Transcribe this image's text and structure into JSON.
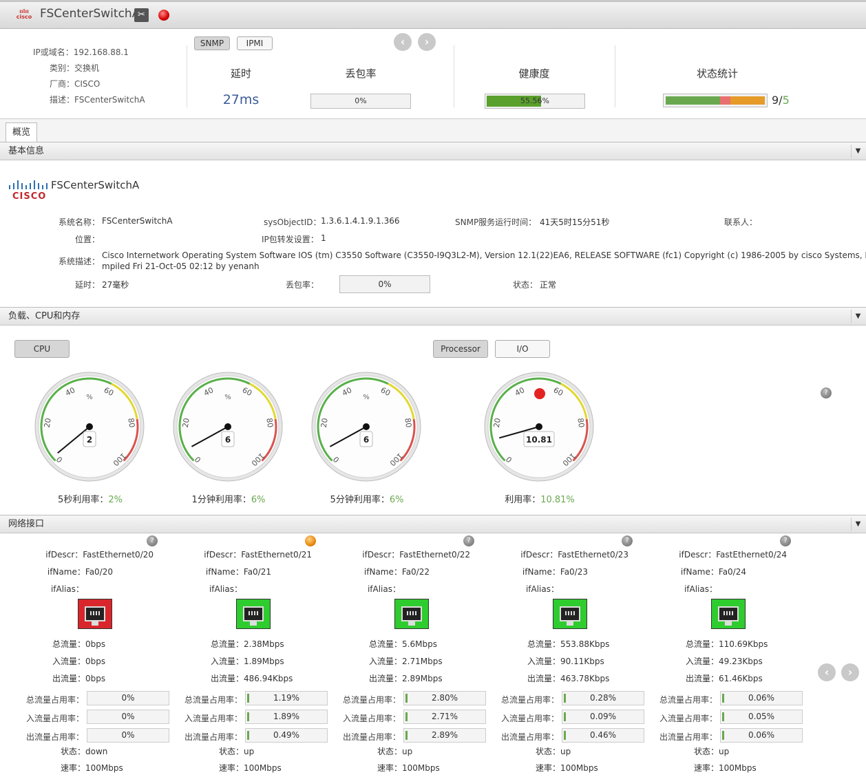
{
  "header": {
    "device_name": "FSCenterSwitchA",
    "ip_label": "IP或域名：",
    "ip_value": "192.168.88.1",
    "type_label": "类别：",
    "type_value": "交换机",
    "vendor_label": "厂商：",
    "vendor_value": "CISCO",
    "desc_label": "描述：",
    "desc_value": "FSCenterSwitchA",
    "tab_snmp": "SNMP",
    "tab_ipmi": "IPMI",
    "latency_label": "延时",
    "latency_value": "27ms",
    "loss_label": "丢包率",
    "loss_value": "0%",
    "health_label": "健康度",
    "health_value": "55.56%",
    "health_fraction": 0.5556,
    "status_label": "状态统计",
    "status_count": "9/",
    "status_count2": "5",
    "status_segments": [
      {
        "color": "#6aa84f",
        "fraction": 0.55
      },
      {
        "color": "#ea6f6f",
        "fraction": 0.1
      },
      {
        "color": "#e69a28",
        "fraction": 0.35
      }
    ]
  },
  "tabs": {
    "overview": "概览"
  },
  "basic": {
    "section_title": "基本信息",
    "logo_text": "CISCO",
    "device_name": "FSCenterSwitchA",
    "sysname_label": "系统名称：",
    "sysname_value": "FSCenterSwitchA",
    "sysoid_label": "sysObjectID：",
    "sysoid_value": "1.3.6.1.4.1.9.1.366",
    "uptime_label": "SNMP服务运行时间：",
    "uptime_value": "41天5时15分51秒",
    "contact_label": "联系人：",
    "location_label": "位置：",
    "ipfwd_label": "IP包转发设置：",
    "ipfwd_value": "1",
    "sysdesc_label": "系统描述：",
    "sysdesc_line1": "Cisco Internetwork Operating System Software IOS (tm) C3550 Software (C3550-I9Q3L2-M), Version 12.1(22)EA6, RELEASE SOFTWARE (fc1) Copyright (c) 1986-2005 by cisco Systems, Inc. Co",
    "sysdesc_line2": "mpiled Fri 21-Oct-05 02:12 by yenanh",
    "latency_label": "延时：",
    "latency_value": "27毫秒",
    "loss_label": "丢包率：",
    "loss_value": "0%",
    "state_label": "状态：",
    "state_value": "正常"
  },
  "load": {
    "section_title": "负载、CPU和内存",
    "btn_cpu": "CPU",
    "btn_processor": "Processor",
    "btn_io": "I/O",
    "gauges": [
      {
        "value": 2,
        "display": "2",
        "caption": "5秒利用率：",
        "caption_val": "2%",
        "has_alarm": false
      },
      {
        "value": 6,
        "display": "6",
        "caption": "1分钟利用率：",
        "caption_val": "6%",
        "has_alarm": false
      },
      {
        "value": 6,
        "display": "6",
        "caption": "5分钟利用率：",
        "caption_val": "6%",
        "has_alarm": false
      },
      {
        "value": 10.81,
        "display": "10.81",
        "caption": "利用率：",
        "caption_val": "10.81%",
        "has_alarm": true
      }
    ],
    "tick_labels": [
      "0",
      "20",
      "40",
      "60",
      "80",
      "100"
    ],
    "unit": "%"
  },
  "network": {
    "section_title": "网络接口",
    "labels": {
      "ifdescr": "ifDescr：",
      "ifname": "ifName：",
      "ifalias": "ifAlias：",
      "total": "总流量：",
      "in": "入流量：",
      "out": "出流量：",
      "total_pct": "总流量占用率：",
      "in_pct": "入流量占用率：",
      "out_pct": "出流量占用率：",
      "state": "状态：",
      "speed": "速率："
    },
    "interfaces": [
      {
        "ifdescr": "FastEthernet0/20",
        "ifname": "Fa0/20",
        "ifalias": "",
        "port_color": "#d9262c",
        "indicator": "gray",
        "total": "0bps",
        "in": "0bps",
        "out": "0bps",
        "total_pct": "0%",
        "in_pct": "0%",
        "out_pct": "0%",
        "total_pct_f": 0,
        "in_pct_f": 0,
        "out_pct_f": 0,
        "state": "down",
        "speed": "100Mbps"
      },
      {
        "ifdescr": "FastEthernet0/21",
        "ifname": "Fa0/21",
        "ifalias": "",
        "port_color": "#2ecc2e",
        "indicator": "orange",
        "total": "2.38Mbps",
        "in": "1.89Mbps",
        "out": "486.94Kbps",
        "total_pct": "1.19%",
        "in_pct": "1.89%",
        "out_pct": "0.49%",
        "total_pct_f": 0.0119,
        "in_pct_f": 0.0189,
        "out_pct_f": 0.0049,
        "state": "up",
        "speed": "100Mbps"
      },
      {
        "ifdescr": "FastEthernet0/22",
        "ifname": "Fa0/22",
        "ifalias": "",
        "port_color": "#2ecc2e",
        "indicator": "gray",
        "total": "5.6Mbps",
        "in": "2.71Mbps",
        "out": "2.89Mbps",
        "total_pct": "2.80%",
        "in_pct": "2.71%",
        "out_pct": "2.89%",
        "total_pct_f": 0.028,
        "in_pct_f": 0.0271,
        "out_pct_f": 0.0289,
        "state": "up",
        "speed": "100Mbps"
      },
      {
        "ifdescr": "FastEthernet0/23",
        "ifname": "Fa0/23",
        "ifalias": "",
        "port_color": "#2ecc2e",
        "indicator": "gray",
        "total": "553.88Kbps",
        "in": "90.11Kbps",
        "out": "463.78Kbps",
        "total_pct": "0.28%",
        "in_pct": "0.09%",
        "out_pct": "0.46%",
        "total_pct_f": 0.0028,
        "in_pct_f": 0.0009,
        "out_pct_f": 0.0046,
        "state": "up",
        "speed": "100Mbps"
      },
      {
        "ifdescr": "FastEthernet0/24",
        "ifname": "Fa0/24",
        "ifalias": "",
        "port_color": "#2ecc2e",
        "indicator": "gray",
        "total": "110.69Kbps",
        "in": "49.23Kbps",
        "out": "61.46Kbps",
        "total_pct": "0.06%",
        "in_pct": "0.05%",
        "out_pct": "0.06%",
        "total_pct_f": 0.0006,
        "in_pct_f": 0.0005,
        "out_pct_f": 0.0006,
        "state": "up",
        "speed": "100Mbps"
      }
    ]
  },
  "icons": {
    "prev": "chevron-left-icon",
    "next": "chevron-right-icon",
    "collapse": "triangle-down-icon",
    "help": "help-icon"
  }
}
